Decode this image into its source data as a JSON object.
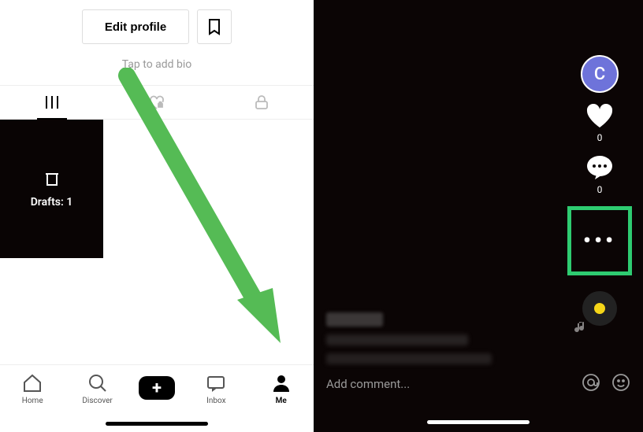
{
  "profile": {
    "edit_button_label": "Edit profile",
    "bio_prompt": "Tap to add bio",
    "drafts_label": "Drafts: 1"
  },
  "nav": {
    "home": "Home",
    "discover": "Discover",
    "inbox": "Inbox",
    "me": "Me"
  },
  "video": {
    "avatar_initial": "C",
    "like_count": "0",
    "comment_count": "0",
    "comment_placeholder": "Add comment...",
    "share_icon_name": "more-icon"
  }
}
